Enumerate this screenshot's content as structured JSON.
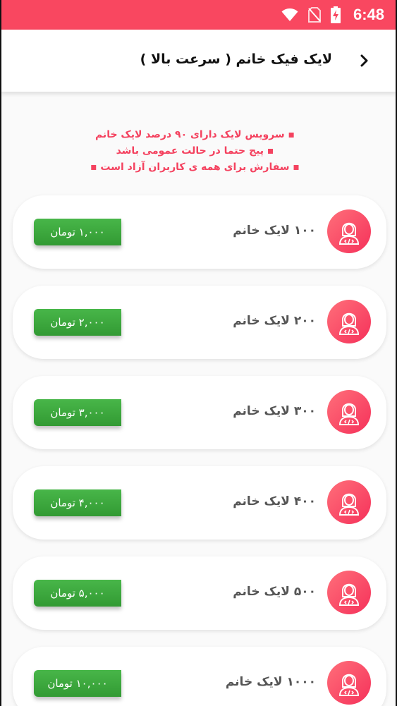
{
  "status_bar": {
    "time": "6:48",
    "icons": [
      "wifi-icon",
      "no-sim-icon",
      "battery-charging-icon"
    ],
    "color": "#f94760"
  },
  "app_bar": {
    "title": "لایک فیک خانم ( سرعت بالا )",
    "back_icon": "chevron-right-icon"
  },
  "notice": {
    "color": "#f4425f",
    "lines": [
      "▪ سرویس  لایک دارای ۹۰ درصد لایک خانم",
      "▪ پیج حتما در حالت عمومی باشد",
      "▪ سفارش برای همه ی کاربران آزاد است ▪"
    ]
  },
  "packages": [
    {
      "label": "۱۰۰ لایک خانم",
      "price": "۱,۰۰۰ تومان"
    },
    {
      "label": "۲۰۰ لایک خانم",
      "price": "۲,۰۰۰ تومان"
    },
    {
      "label": "۳۰۰ لایک خانم",
      "price": "۳,۰۰۰ تومان"
    },
    {
      "label": "۴۰۰ لایک خانم",
      "price": "۴,۰۰۰ تومان"
    },
    {
      "label": "۵۰۰ لایک خانم",
      "price": "۵,۰۰۰ تومان"
    },
    {
      "label": "۱۰۰۰ لایک خانم",
      "price": "۱۰,۰۰۰ تومان"
    }
  ],
  "colors": {
    "accent": "#f94760",
    "price_button": "#3aa83b",
    "avatar": "#f5455f"
  }
}
